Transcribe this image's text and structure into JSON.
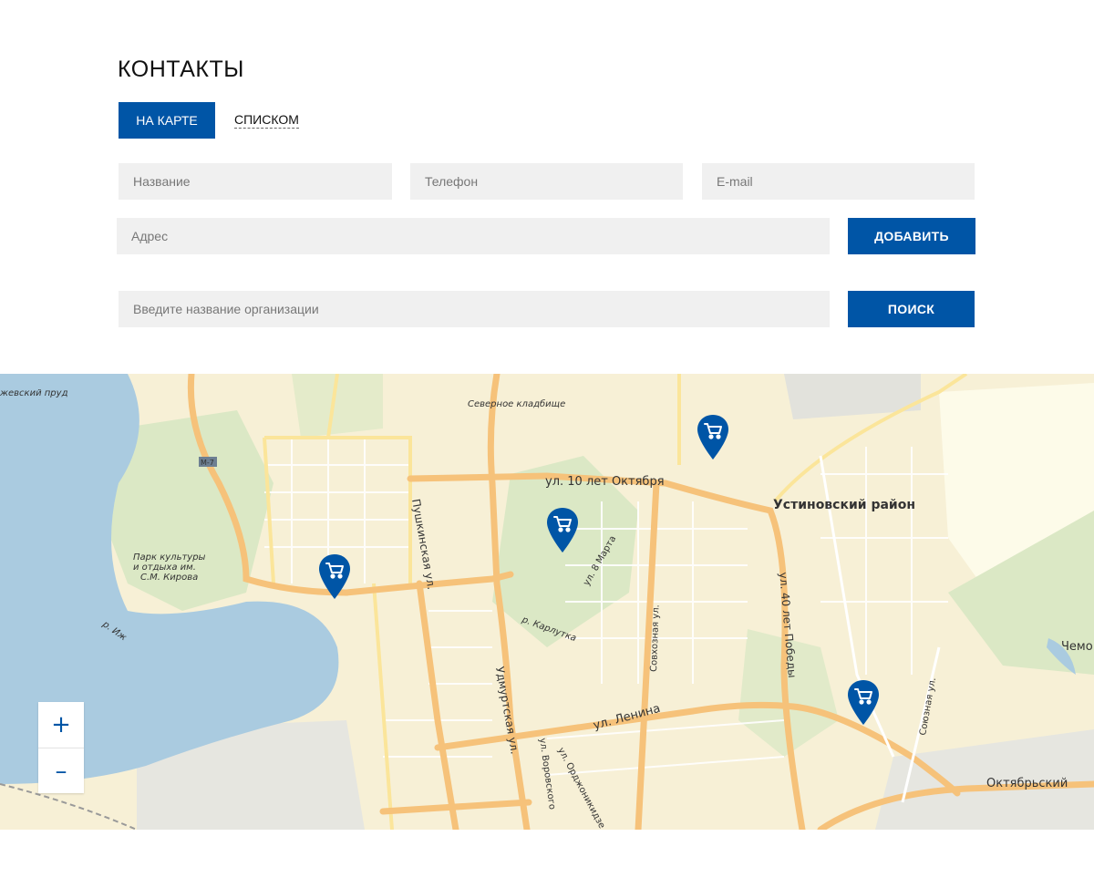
{
  "page": {
    "title": "КОНТАКТЫ"
  },
  "tabs": {
    "map": "НА КАРТЕ",
    "list": "СПИСКОМ"
  },
  "form": {
    "name_placeholder": "Название",
    "phone_placeholder": "Телефон",
    "email_placeholder": "E-mail",
    "address_placeholder": "Адрес",
    "add_label": "ДОБАВИТЬ"
  },
  "search": {
    "placeholder": "Введите название организации",
    "button_label": "ПОИСК"
  },
  "map": {
    "labels": {
      "pond": "жевский пруд",
      "cemetery": "Северное кладбище",
      "highway": "М-7",
      "october_street": "ул. 10 лет Октября",
      "district": "Устиновский район",
      "pushkinskaya": "Пушкинская ул.",
      "park_1": "Парк культуры",
      "park_2": "и отдыха им.",
      "park_3": "С.М. Кирова",
      "march_8": "ул. 8 Марта",
      "pobedy": "ул. 40 лет Победы",
      "river_izh": "р. Иж",
      "karlutka": "р. Карлутка",
      "sovkhoznaya": "Совхозная ул.",
      "udmurtskaya": "Удмуртская ул.",
      "lenina": "ул. Ленина",
      "soyuznaya": "Союзная ул.",
      "chemo": "Чемо",
      "oktyabrsky": "Октябрьский",
      "vorovskogo": "ул. Воровского",
      "ordzhonikidze": "ул. Орджоникидзе"
    },
    "markers": [
      {
        "id": "store-1",
        "icon": "cart-icon"
      },
      {
        "id": "store-2",
        "icon": "cart-icon"
      },
      {
        "id": "store-3",
        "icon": "cart-icon"
      },
      {
        "id": "store-4",
        "icon": "cart-icon"
      }
    ],
    "zoom_in": "+",
    "zoom_out": "–"
  },
  "colors": {
    "accent": "#0055a6",
    "field_bg": "#f0f0f0",
    "map_land": "#f7f0d6",
    "map_water": "#aacbe0",
    "map_road": "#f6c27a",
    "map_green": "#dbe8c5"
  }
}
